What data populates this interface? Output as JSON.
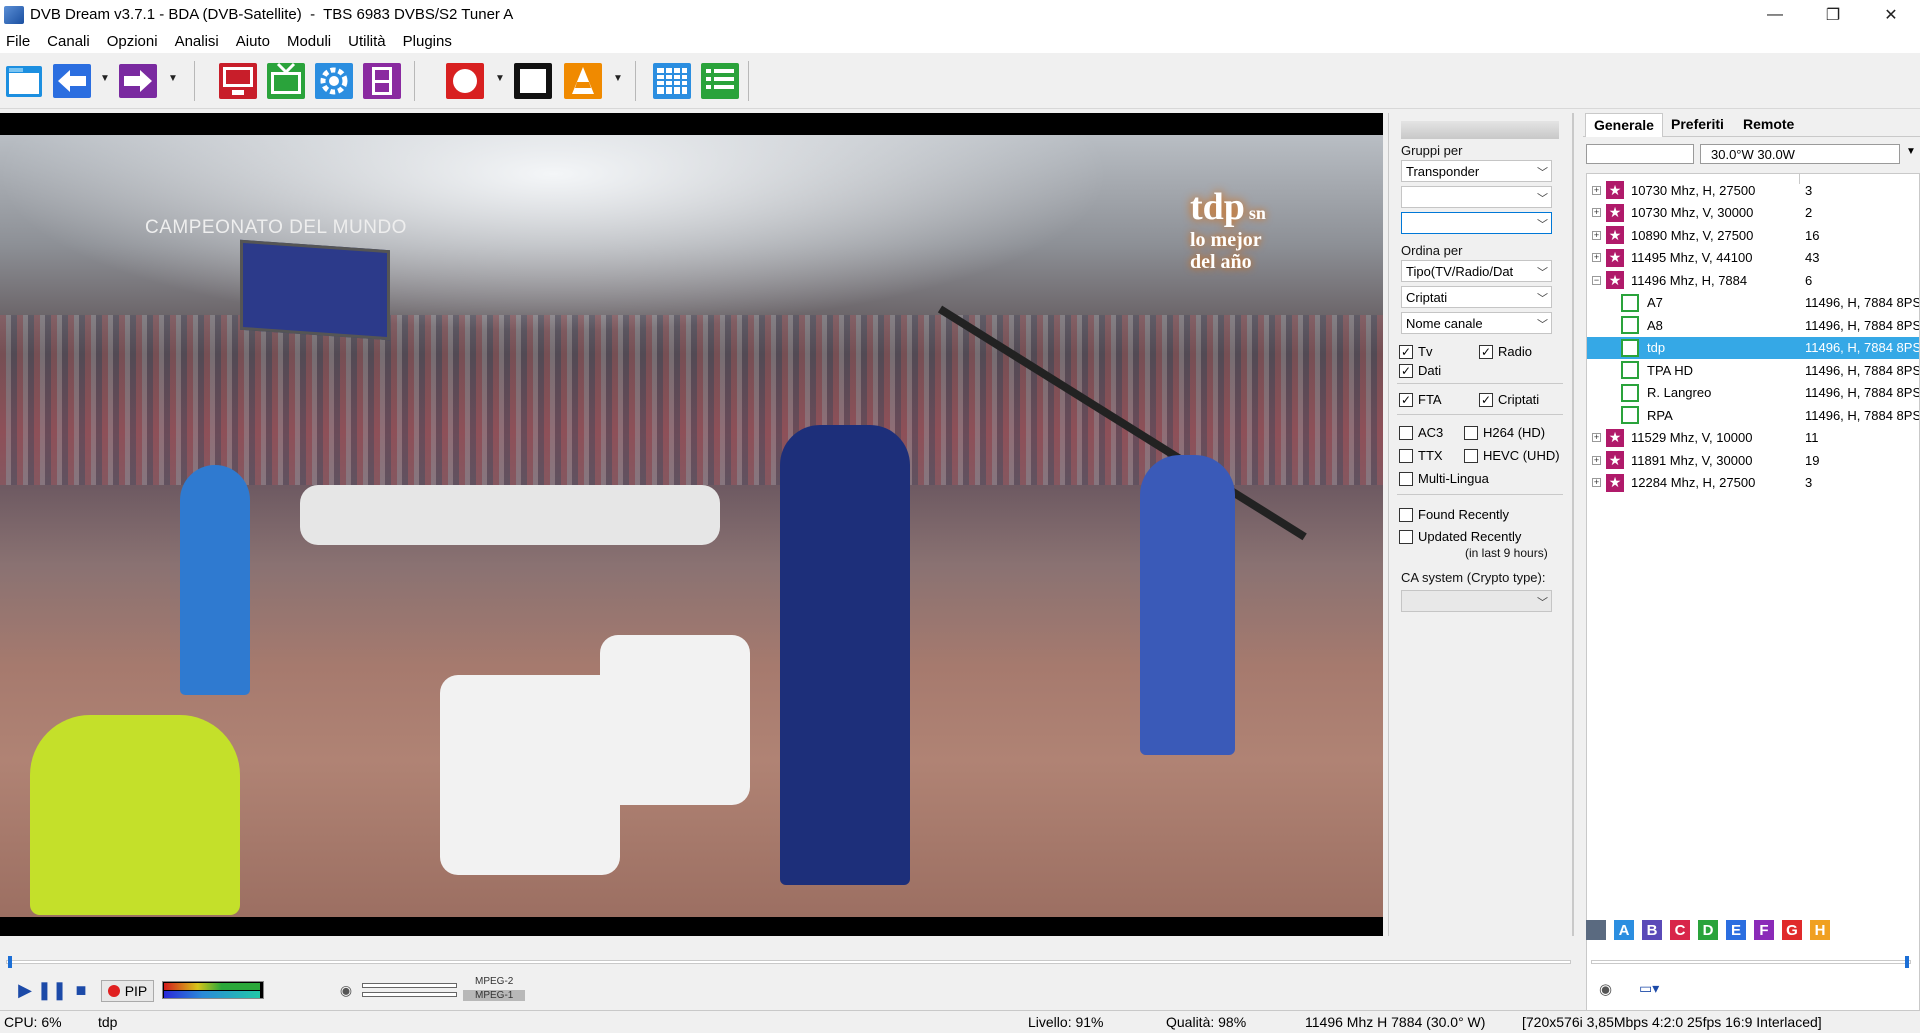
{
  "window": {
    "title": "DVB Dream v3.7.1 - BDA (DVB-Satellite)  -  TBS 6983 DVBS/S2 Tuner A",
    "minimize": "—",
    "maximize": "❐",
    "close": "✕"
  },
  "menu": [
    "File",
    "Canali",
    "Opzioni",
    "Analisi",
    "Aiuto",
    "Moduli",
    "Utilità",
    "Plugins"
  ],
  "toolbar": {
    "icons": [
      "folder-open-icon",
      "back-arrow-icon",
      "forward-arrow-icon",
      "tv-monitor-icon",
      "tv-channel-icon",
      "settings-gear-icon",
      "film-strip-icon",
      "record-icon",
      "stop-square-icon",
      "vlc-cone-icon",
      "grid-table-icon",
      "list-icon"
    ],
    "colors": {
      "blue": "#1c6fd6",
      "red": "#d82020",
      "green": "#2aa33b",
      "purple": "#7a2aa0",
      "orange": "#f08a00"
    }
  },
  "video": {
    "overlay_text": "CAMPEONATO DEL MUNDO",
    "logo_main": "tdp",
    "logo_tag": "sn",
    "logo_sub1": "lo mejor",
    "logo_sub2": "del año"
  },
  "filters": {
    "group_label": "Gruppi per",
    "group_value": "Transponder",
    "group2_value": "",
    "group3_value": "",
    "order_label": "Ordina per",
    "order1": "Tipo(TV/Radio/Dat",
    "order2": "Criptati",
    "order3": "Nome canale",
    "tv": "Tv",
    "radio": "Radio",
    "dati": "Dati",
    "fta": "FTA",
    "criptati": "Criptati",
    "ac3": "AC3",
    "h264": "H264 (HD)",
    "ttx": "TTX",
    "hevc": "HEVC (UHD)",
    "multilingua": "Multi-Lingua",
    "found_recently": "Found Recently",
    "updated_recently": "Updated Recently",
    "updated_note": "(in last 9 hours)",
    "ca_label": "CA system (Crypto type):",
    "ca_value": "",
    "checked": {
      "tv": true,
      "radio": true,
      "dati": true,
      "fta": true,
      "criptati": true,
      "ac3": false,
      "h264": false,
      "ttx": false,
      "hevc": false,
      "multilingua": false,
      "found": false,
      "updated": false
    }
  },
  "tabs": [
    "Generale",
    "Preferiti",
    "Remote"
  ],
  "satellite": "30.0°W 30.0W",
  "tree": [
    {
      "type": "tp",
      "name": "10730 Mhz, H, 27500",
      "val": "3",
      "exp": "+"
    },
    {
      "type": "tp",
      "name": "10730 Mhz, V, 30000",
      "val": "2",
      "exp": "+"
    },
    {
      "type": "tp",
      "name": "10890 Mhz, V, 27500",
      "val": "16",
      "exp": "+"
    },
    {
      "type": "tp",
      "name": "11495 Mhz, V, 44100",
      "val": "43",
      "exp": "+"
    },
    {
      "type": "tp",
      "name": "11496 Mhz, H, 7884",
      "val": "6",
      "exp": "−"
    },
    {
      "type": "ch",
      "name": "A7",
      "val": "11496, H, 7884 8PS"
    },
    {
      "type": "ch",
      "name": "A8",
      "val": "11496, H, 7884 8PS"
    },
    {
      "type": "ch",
      "name": "tdp",
      "val": "11496, H, 7884 8PS",
      "selected": true
    },
    {
      "type": "ch",
      "name": "TPA HD",
      "val": "11496, H, 7884 8PS"
    },
    {
      "type": "ch",
      "name": "R. Langreo",
      "val": "11496, H, 7884 8PS"
    },
    {
      "type": "ch",
      "name": "RPA",
      "val": "11496, H, 7884 8PS"
    },
    {
      "type": "tp",
      "name": "11529 Mhz, V, 10000",
      "val": "11",
      "exp": "+"
    },
    {
      "type": "tp",
      "name": "11891 Mhz, V, 30000",
      "val": "19",
      "exp": "+"
    },
    {
      "type": "tp",
      "name": "12284 Mhz, H, 27500",
      "val": "3",
      "exp": "+"
    }
  ],
  "favorites": [
    {
      "label": "",
      "color": "#5a6a80"
    },
    {
      "label": "A",
      "color": "#2b8ee0"
    },
    {
      "label": "B",
      "color": "#5a4ab8"
    },
    {
      "label": "C",
      "color": "#d8264a"
    },
    {
      "label": "D",
      "color": "#2aa33b"
    },
    {
      "label": "E",
      "color": "#2b6ee0"
    },
    {
      "label": "F",
      "color": "#8a2ab8"
    },
    {
      "label": "G",
      "color": "#e02a2a"
    },
    {
      "label": "H",
      "color": "#f0a020"
    }
  ],
  "controls": {
    "pip": "PIP",
    "codec1": "MPEG-2",
    "codec2": "MPEG-1"
  },
  "status": {
    "cpu": "CPU: 6%",
    "channel": "tdp",
    "level": "Livello: 91%",
    "quality": "Qualità: 98%",
    "tuning": "11496 Mhz  H  7884  (30.0° W)",
    "format": "[720x576i  3,85Mbps 4:2:0 25fps 16:9 Interlaced]"
  }
}
